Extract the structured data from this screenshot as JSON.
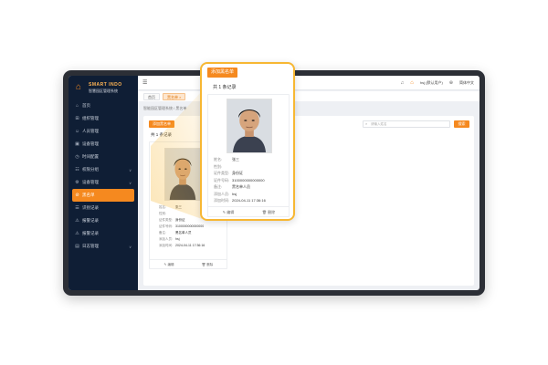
{
  "brand": {
    "logo_en": "SMART INDO",
    "logo_cn": "智慧园区管理系统",
    "accent": "#f5891f",
    "sidebar_bg": "#0f1e35",
    "callout_border": "#f7b733"
  },
  "sidebar": {
    "items": [
      {
        "label": "首页",
        "icon": "home-icon"
      },
      {
        "label": "组织管理",
        "icon": "org-icon"
      },
      {
        "label": "人员管理",
        "icon": "person-icon"
      },
      {
        "label": "设备管理",
        "icon": "device-icon"
      },
      {
        "label": "时间配置",
        "icon": "clock-icon"
      },
      {
        "label": "权限分组",
        "icon": "permission-icon",
        "expandable": true
      },
      {
        "label": "设备管理",
        "icon": "device-icon",
        "expandable": true
      },
      {
        "label": "黑名单",
        "icon": "blacklist-icon",
        "active": true
      },
      {
        "label": "识别记录",
        "icon": "record-icon"
      },
      {
        "label": "报警记录",
        "icon": "alarm-icon"
      },
      {
        "label": "报警记录",
        "icon": "alarm-icon"
      },
      {
        "label": "日志管理",
        "icon": "log-icon",
        "expandable": true
      }
    ]
  },
  "topbar": {
    "user": "hsj (默认用户)",
    "language": "简体中文"
  },
  "tabs": [
    {
      "label": "首页"
    },
    {
      "label": "黑名单 ×",
      "active": true
    }
  ],
  "breadcrumb": "智能园区管理系统 / 黑名单",
  "toolbar": {
    "add_label": "添加黑名单",
    "search_placeholder": "请输入姓名",
    "search_label": "搜索"
  },
  "list": {
    "count_label": "共 1 条记录",
    "cards": [
      {
        "fields": [
          {
            "key": "姓名:",
            "value": "张三"
          },
          {
            "key": "性别:",
            "value": ""
          },
          {
            "key": "证件类型:",
            "value": "身份证"
          },
          {
            "key": "证件号码:",
            "value": "3100000000000000"
          },
          {
            "key": "备注:",
            "value": "黑名单人员"
          },
          {
            "key": "添加人员:",
            "value": "hsj"
          },
          {
            "key": "添加时间:",
            "value": "2024-04-11 17:36:16"
          }
        ],
        "actions": {
          "edit": "编辑",
          "delete": "删除"
        }
      }
    ]
  }
}
